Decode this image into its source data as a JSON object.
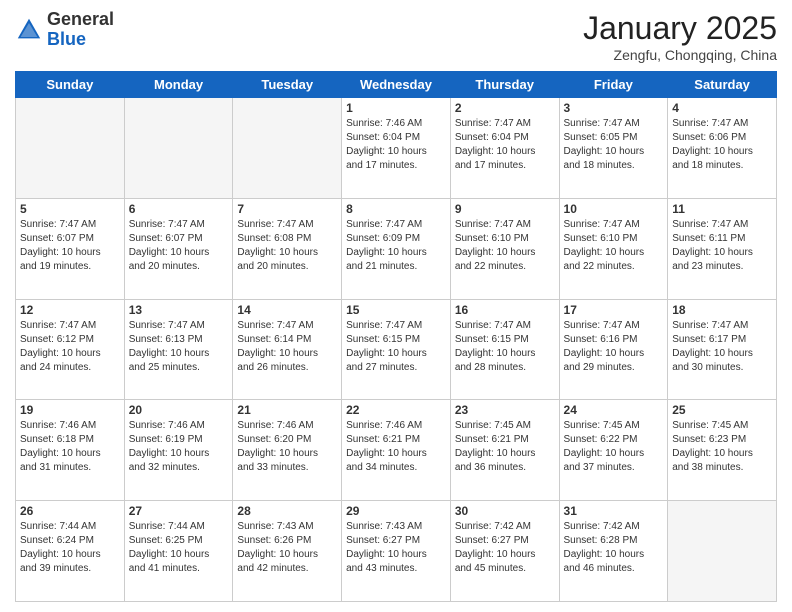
{
  "header": {
    "logo_general": "General",
    "logo_blue": "Blue",
    "month_title": "January 2025",
    "location": "Zengfu, Chongqing, China"
  },
  "weekdays": [
    "Sunday",
    "Monday",
    "Tuesday",
    "Wednesday",
    "Thursday",
    "Friday",
    "Saturday"
  ],
  "weeks": [
    [
      {
        "day": "",
        "info": ""
      },
      {
        "day": "",
        "info": ""
      },
      {
        "day": "",
        "info": ""
      },
      {
        "day": "1",
        "info": "Sunrise: 7:46 AM\nSunset: 6:04 PM\nDaylight: 10 hours\nand 17 minutes."
      },
      {
        "day": "2",
        "info": "Sunrise: 7:47 AM\nSunset: 6:04 PM\nDaylight: 10 hours\nand 17 minutes."
      },
      {
        "day": "3",
        "info": "Sunrise: 7:47 AM\nSunset: 6:05 PM\nDaylight: 10 hours\nand 18 minutes."
      },
      {
        "day": "4",
        "info": "Sunrise: 7:47 AM\nSunset: 6:06 PM\nDaylight: 10 hours\nand 18 minutes."
      }
    ],
    [
      {
        "day": "5",
        "info": "Sunrise: 7:47 AM\nSunset: 6:07 PM\nDaylight: 10 hours\nand 19 minutes."
      },
      {
        "day": "6",
        "info": "Sunrise: 7:47 AM\nSunset: 6:07 PM\nDaylight: 10 hours\nand 20 minutes."
      },
      {
        "day": "7",
        "info": "Sunrise: 7:47 AM\nSunset: 6:08 PM\nDaylight: 10 hours\nand 20 minutes."
      },
      {
        "day": "8",
        "info": "Sunrise: 7:47 AM\nSunset: 6:09 PM\nDaylight: 10 hours\nand 21 minutes."
      },
      {
        "day": "9",
        "info": "Sunrise: 7:47 AM\nSunset: 6:10 PM\nDaylight: 10 hours\nand 22 minutes."
      },
      {
        "day": "10",
        "info": "Sunrise: 7:47 AM\nSunset: 6:10 PM\nDaylight: 10 hours\nand 22 minutes."
      },
      {
        "day": "11",
        "info": "Sunrise: 7:47 AM\nSunset: 6:11 PM\nDaylight: 10 hours\nand 23 minutes."
      }
    ],
    [
      {
        "day": "12",
        "info": "Sunrise: 7:47 AM\nSunset: 6:12 PM\nDaylight: 10 hours\nand 24 minutes."
      },
      {
        "day": "13",
        "info": "Sunrise: 7:47 AM\nSunset: 6:13 PM\nDaylight: 10 hours\nand 25 minutes."
      },
      {
        "day": "14",
        "info": "Sunrise: 7:47 AM\nSunset: 6:14 PM\nDaylight: 10 hours\nand 26 minutes."
      },
      {
        "day": "15",
        "info": "Sunrise: 7:47 AM\nSunset: 6:15 PM\nDaylight: 10 hours\nand 27 minutes."
      },
      {
        "day": "16",
        "info": "Sunrise: 7:47 AM\nSunset: 6:15 PM\nDaylight: 10 hours\nand 28 minutes."
      },
      {
        "day": "17",
        "info": "Sunrise: 7:47 AM\nSunset: 6:16 PM\nDaylight: 10 hours\nand 29 minutes."
      },
      {
        "day": "18",
        "info": "Sunrise: 7:47 AM\nSunset: 6:17 PM\nDaylight: 10 hours\nand 30 minutes."
      }
    ],
    [
      {
        "day": "19",
        "info": "Sunrise: 7:46 AM\nSunset: 6:18 PM\nDaylight: 10 hours\nand 31 minutes."
      },
      {
        "day": "20",
        "info": "Sunrise: 7:46 AM\nSunset: 6:19 PM\nDaylight: 10 hours\nand 32 minutes."
      },
      {
        "day": "21",
        "info": "Sunrise: 7:46 AM\nSunset: 6:20 PM\nDaylight: 10 hours\nand 33 minutes."
      },
      {
        "day": "22",
        "info": "Sunrise: 7:46 AM\nSunset: 6:21 PM\nDaylight: 10 hours\nand 34 minutes."
      },
      {
        "day": "23",
        "info": "Sunrise: 7:45 AM\nSunset: 6:21 PM\nDaylight: 10 hours\nand 36 minutes."
      },
      {
        "day": "24",
        "info": "Sunrise: 7:45 AM\nSunset: 6:22 PM\nDaylight: 10 hours\nand 37 minutes."
      },
      {
        "day": "25",
        "info": "Sunrise: 7:45 AM\nSunset: 6:23 PM\nDaylight: 10 hours\nand 38 minutes."
      }
    ],
    [
      {
        "day": "26",
        "info": "Sunrise: 7:44 AM\nSunset: 6:24 PM\nDaylight: 10 hours\nand 39 minutes."
      },
      {
        "day": "27",
        "info": "Sunrise: 7:44 AM\nSunset: 6:25 PM\nDaylight: 10 hours\nand 41 minutes."
      },
      {
        "day": "28",
        "info": "Sunrise: 7:43 AM\nSunset: 6:26 PM\nDaylight: 10 hours\nand 42 minutes."
      },
      {
        "day": "29",
        "info": "Sunrise: 7:43 AM\nSunset: 6:27 PM\nDaylight: 10 hours\nand 43 minutes."
      },
      {
        "day": "30",
        "info": "Sunrise: 7:42 AM\nSunset: 6:27 PM\nDaylight: 10 hours\nand 45 minutes."
      },
      {
        "day": "31",
        "info": "Sunrise: 7:42 AM\nSunset: 6:28 PM\nDaylight: 10 hours\nand 46 minutes."
      },
      {
        "day": "",
        "info": ""
      }
    ]
  ]
}
